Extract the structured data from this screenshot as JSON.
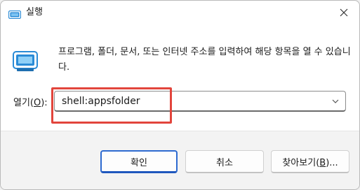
{
  "window": {
    "title": "실행"
  },
  "main": {
    "description": "프로그램, 폴더, 문서, 또는 인터넷 주소를 입력하여 해당 항목을 열 수 있습니다.",
    "open_label": "열기",
    "open_accel_prefix": "(",
    "open_accel_key": "O",
    "open_accel_suffix": "):",
    "command_value": "shell:appsfolder"
  },
  "footer": {
    "ok_label": "확인",
    "cancel_label": "취소",
    "browse_label": "찾아보기",
    "browse_accel_prefix": "(",
    "browse_accel_key": "B",
    "browse_accel_suffix": ")..."
  },
  "icons": {
    "title": "run-icon",
    "close": "close-icon",
    "dialog": "run-icon",
    "dropdown": "chevron-down-icon"
  },
  "colors": {
    "accent": "#2d6ad0",
    "highlight": "#e2453c",
    "run_icon": "#2a8bd6"
  }
}
